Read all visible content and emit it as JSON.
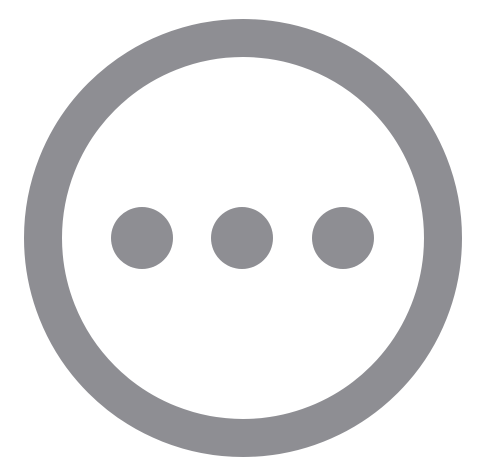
{
  "icon": {
    "name": "more-options-icon",
    "color": "#8e8e93",
    "background": "#ffffff"
  }
}
